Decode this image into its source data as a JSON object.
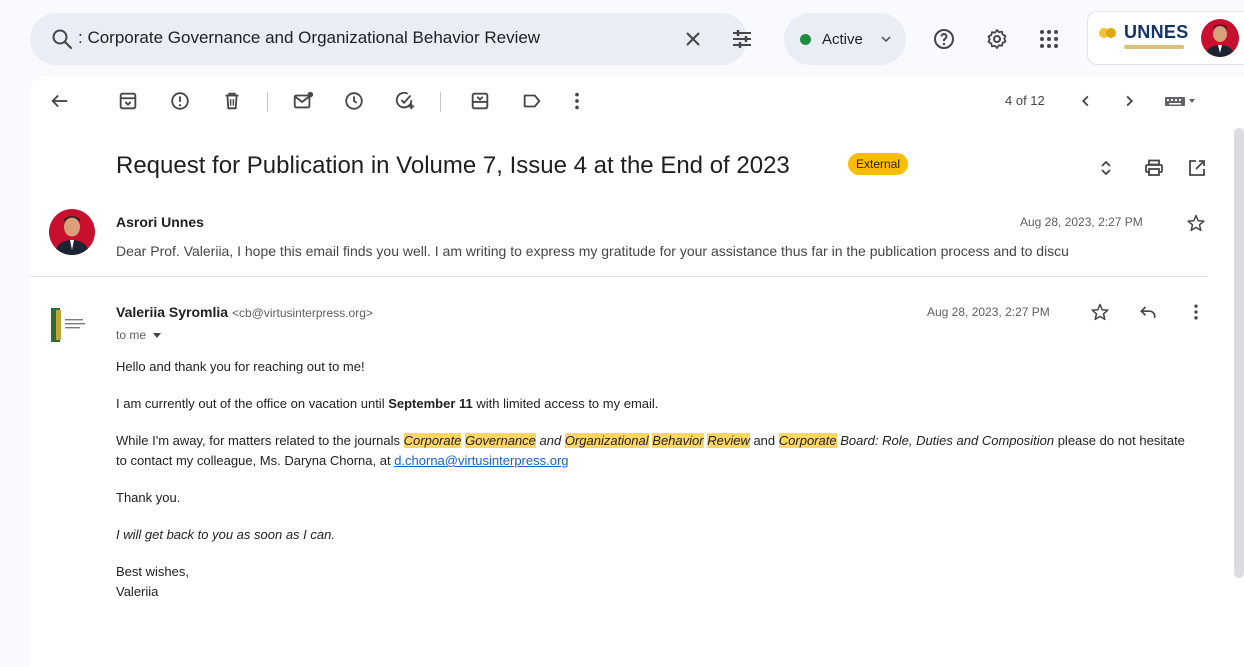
{
  "search": {
    "query": ": Corporate Governance and Organizational Behavior Review",
    "icon": "search-icon"
  },
  "status": {
    "label": "Active",
    "color": "#1e8e3e"
  },
  "account": {
    "org_logo_text": "UNNES"
  },
  "toolbar": {
    "pager": "4 of 12"
  },
  "thread": {
    "subject": "Request for Publication in Volume 7, Issue 4 at the End of 2023",
    "badge": "External",
    "badge_color": "#fbbc04"
  },
  "messages": [
    {
      "sender": "Asrori Unnes",
      "date": "Aug 28, 2023, 2:27 PM",
      "snippet": "Dear Prof. Valeriia, I hope this email finds you well. I am writing to express my gratitude for your assistance thus far in the publication process and to discu"
    },
    {
      "sender": "Valeriia Syromlia",
      "sender_email": "<cb@virtusinterpress.org>",
      "recipient": "to me",
      "date": "Aug 28, 2023, 2:27 PM",
      "body": {
        "p1": "Hello and thank you for reaching out to me!",
        "p2_a": "I am currently out of the office on vacation until ",
        "p2_b": "September 11",
        "p2_c": " with limited access to my email.",
        "p3_a": "While I'm away, for matters related to the journals ",
        "p3_j1a": "Corporate",
        "p3_j1b": "Governance",
        "p3_and1": " and ",
        "p3_j1c": "Organizational",
        "p3_j1d": "Behavior",
        "p3_j1e": "Review",
        "p3_and2": " and ",
        "p3_j2a": "Corporate",
        "p3_j2b": " Board: Role, Duties and Composition",
        "p3_b": " please do not hesitate to contact my colleague, Ms. Daryna Chorna, at ",
        "p3_link": "d.chorna@virtusinterpress.org",
        "p4": "Thank you.",
        "p5": "I will get back to you as soon as I can.",
        "p6_a": "Best wishes,",
        "p6_b": "Valeriia"
      }
    }
  ]
}
